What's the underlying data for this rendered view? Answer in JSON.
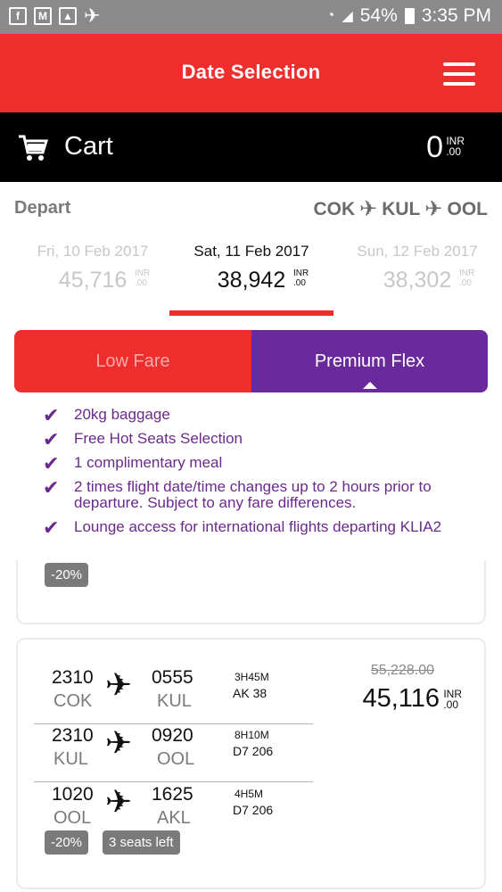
{
  "status_bar": {
    "left_icons": [
      "facebook-icon",
      "gmail-icon",
      "gallery-icon",
      "airplane-icon"
    ],
    "battery": "54%",
    "time": "3:35 PM"
  },
  "header": {
    "title": "Date Selection",
    "menu_icon": "hamburger-menu-icon"
  },
  "cart": {
    "label": "Cart",
    "amount": "0",
    "currency": "INR",
    "decimals": ".00"
  },
  "depart": {
    "label": "Depart",
    "route": [
      "COK",
      "KUL",
      "OOL"
    ]
  },
  "dates": [
    {
      "date": "Fri, 10 Feb 2017",
      "price": "45,716",
      "currency": "INR",
      "decimals": ".00",
      "selected": false
    },
    {
      "date": "Sat, 11 Feb 2017",
      "price": "38,942",
      "currency": "INR",
      "decimals": ".00",
      "selected": true
    },
    {
      "date": "Sun, 12 Feb 2017",
      "price": "38,302",
      "currency": "INR",
      "decimals": ".00",
      "selected": false
    }
  ],
  "fare_tabs": {
    "low": "Low Fare",
    "premium": "Premium Flex",
    "active": "premium"
  },
  "features": [
    "20kg baggage",
    "Free Hot Seats Selection",
    "1 complimentary meal",
    "2 times flight date/time changes up to 2 hours prior to departure. Subject to any fare differences.",
    "Lounge access for international flights departing KLIA2"
  ],
  "card1": {
    "badge": "-20%"
  },
  "card2": {
    "segments": [
      {
        "dep_time": "2310",
        "dep_airport": "COK",
        "arr_time": "0555",
        "arr_airport": "KUL",
        "duration": "3H45M",
        "flight": "AK 38"
      },
      {
        "dep_time": "2310",
        "dep_airport": "KUL",
        "arr_time": "0920",
        "arr_airport": "OOL",
        "duration": "8H10M",
        "flight": "D7 206"
      },
      {
        "dep_time": "1020",
        "dep_airport": "OOL",
        "arr_time": "1625",
        "arr_airport": "AKL",
        "duration": "4H5M",
        "flight": "D7 206"
      }
    ],
    "old_price": "55,228.00",
    "price": "45,116",
    "currency": "INR",
    "decimals": ".00",
    "discount_badge": "-20%",
    "seats_badge": "3 seats left"
  },
  "colors": {
    "brand_red": "#ee2d2d",
    "premium_purple": "#6a2a9b",
    "feature_purple": "#6a2a8b"
  }
}
